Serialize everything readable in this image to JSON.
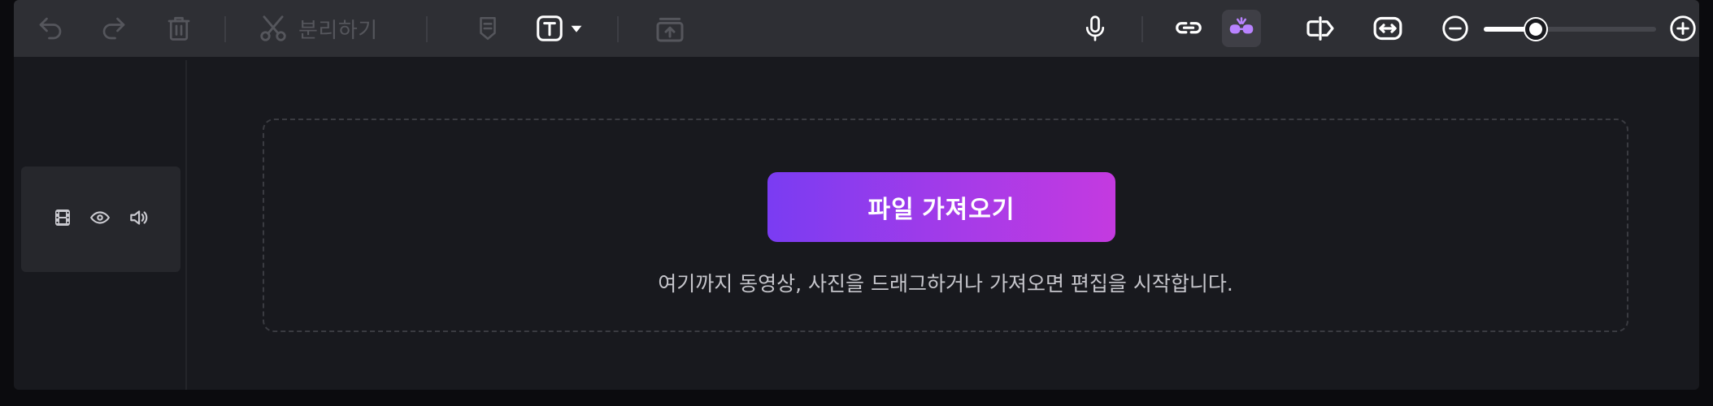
{
  "toolbar": {
    "undo_icon": "undo-icon",
    "redo_icon": "redo-icon",
    "delete_icon": "trash-icon",
    "split_icon": "scissors-icon",
    "split_label": "분리하기",
    "marker_icon": "marker-icon",
    "text_icon": "text-icon",
    "text_dropdown_icon": "caret-down-icon",
    "export_frame_icon": "frame-export-icon",
    "mic_icon": "microphone-icon",
    "link_icon": "link-icon",
    "ai_icon": "ai-bug-icon",
    "trim_icon": "split-clip-icon",
    "fit_icon": "fit-width-icon",
    "zoom_out_icon": "zoom-out-icon",
    "zoom_in_icon": "zoom-in-icon",
    "zoom_level": 0.3,
    "disabled_color": "#55565c",
    "enabled_color": "#ffffff",
    "accent_color": "#b983ff"
  },
  "track_head": {
    "film_icon": "film-icon",
    "eye_icon": "eye-icon",
    "speaker_icon": "speaker-icon"
  },
  "drop_zone": {
    "import_button_label": "파일 가져오기",
    "hint": "여기까지 동영상, 사진을 드래그하거나 가져오면 편집을 시작합니다."
  },
  "colors": {
    "gradient_start": "#7a3cf2",
    "gradient_end": "#c43ae0",
    "background": "#18191e",
    "toolbar": "#2e2f34"
  }
}
